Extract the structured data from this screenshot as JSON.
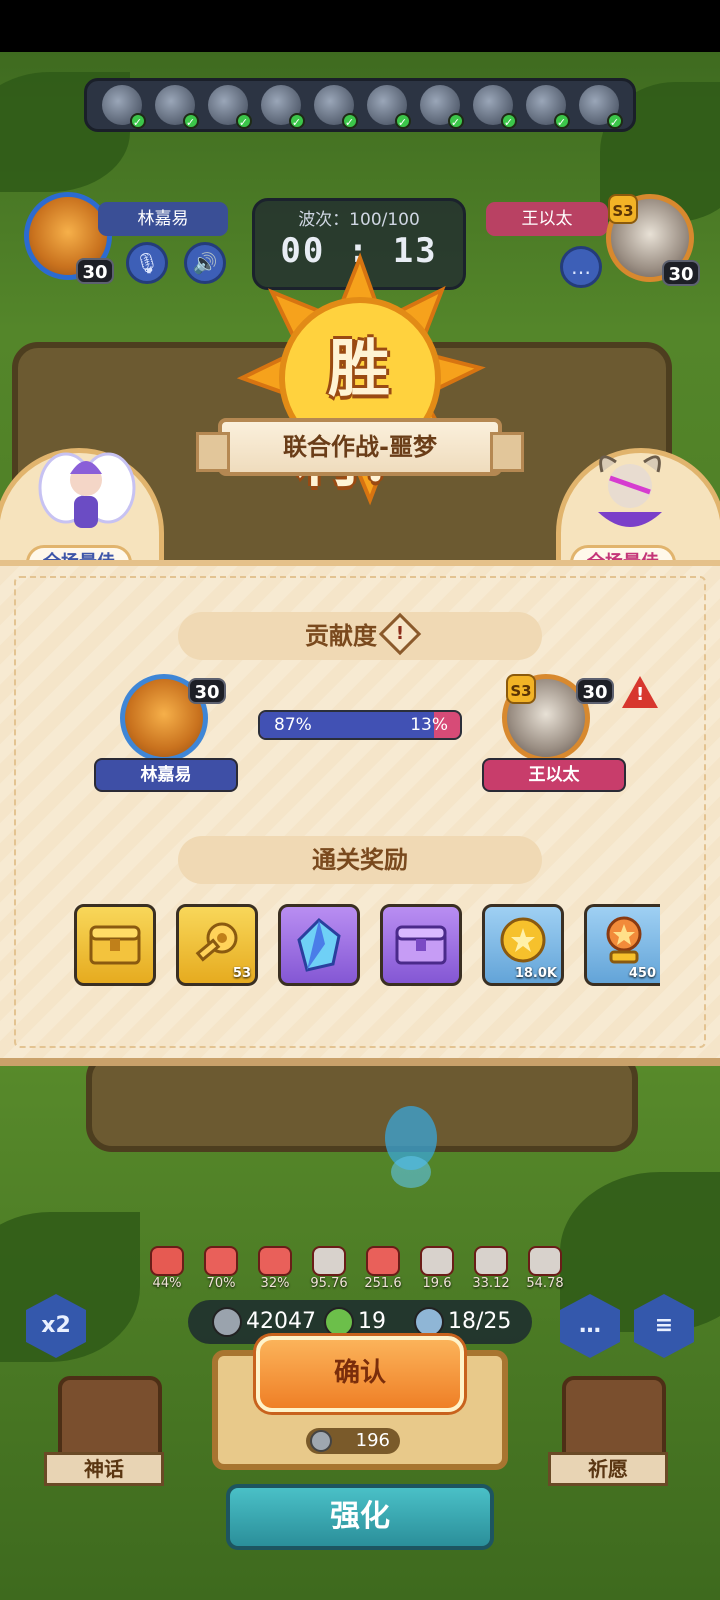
{
  "top": {
    "roster_count": 10,
    "left_player": {
      "name": "林嘉易",
      "level": "30"
    },
    "right_player": {
      "name": "王以太",
      "level": "30",
      "season": "S3"
    },
    "wave": "波次：100/100",
    "timer": "00 : 13"
  },
  "victory": {
    "title": "胜利！",
    "stage": "联合作战-噩梦",
    "mvp_left": "全场最佳",
    "mvp_right": "全场最佳"
  },
  "contribution": {
    "title": "贡献度",
    "info_icon": "!",
    "left": {
      "name": "林嘉易",
      "level": "30",
      "percent": "87%",
      "share": 0.87
    },
    "right": {
      "name": "王以太",
      "level": "30",
      "season": "S3",
      "percent": "13%"
    },
    "warning_icon": "!"
  },
  "rewards": {
    "title": "通关奖励",
    "items": [
      {
        "icon": "gold-chest-icon",
        "count": ""
      },
      {
        "icon": "gold-key-icon",
        "count": "53"
      },
      {
        "icon": "crystal-icon",
        "count": ""
      },
      {
        "icon": "purple-chest-icon",
        "count": ""
      },
      {
        "icon": "coin-icon",
        "count": "18.0K"
      },
      {
        "icon": "trophy-icon",
        "count": "450"
      }
    ]
  },
  "stats": [
    "44%",
    "70%",
    "32%",
    "95.76",
    "251.6",
    "19.6",
    "33.12",
    "54.78"
  ],
  "resources": {
    "silver": "42047",
    "clover": "19",
    "units": "18/25"
  },
  "buttons": {
    "speed": "x2",
    "confirm": "确认",
    "cost": "196",
    "upgrade": "强化",
    "myth": "神话",
    "pray": "祈愿"
  },
  "colors": {
    "blue_team": "#4151b4",
    "red_team": "#d74b77",
    "confirm": "#ef7f26"
  }
}
